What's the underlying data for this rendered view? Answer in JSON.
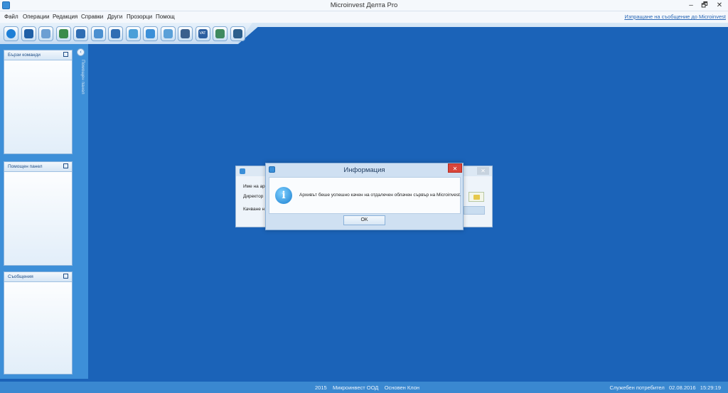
{
  "window": {
    "title": "Microinvest Делта Pro",
    "controls": {
      "minimize": "‒",
      "maximize": "🗗",
      "close": "✕"
    }
  },
  "menu": {
    "items": [
      "Файл",
      "Операции",
      "Редакция",
      "Справки",
      "Други",
      "Прозорци",
      "Помощ"
    ],
    "feedback_link": "Изпращане на съобщение до Microinvest"
  },
  "toolbar": {
    "buttons": [
      "globe-icon",
      "operations-icon",
      "documents-icon",
      "payments-icon",
      "cash-icon",
      "partners-icon",
      "items-icon",
      "users-icon",
      "objects-icon",
      "timer-icon",
      "lock-icon",
      "vat-icon",
      "export-icon",
      "settings-icon"
    ],
    "colors": [
      "#1e7fd6",
      "#1f5fa6",
      "#6c9fd3",
      "#3a8c4a",
      "#2f6db3",
      "#4a8fd0",
      "#2f6db3",
      "#4a9fd8",
      "#3b8fd8",
      "#5aa0d8",
      "#3a5f8c",
      "#2c5fa0",
      "#3f8a5f",
      "#2c5f8c"
    ],
    "vat_label": "VAT"
  },
  "sidebar": {
    "collapse_glyph": "‹",
    "vertical_tab": "Помощен панел",
    "panels": [
      {
        "title": "Бързи команди"
      },
      {
        "title": "Помощен панел"
      },
      {
        "title": "Съобщения"
      }
    ]
  },
  "back_dialog": {
    "close_glyph": "✕",
    "label_name": "Име на ар",
    "label_dir": "Директор",
    "label_upload": "Качване н"
  },
  "info_dialog": {
    "title": "Информация",
    "close_glyph": "✕",
    "icon_glyph": "i",
    "message": "Архивът беше успешно качен на отдалечен облачен сървър на Microinvest.",
    "ok_label": "OK"
  },
  "status": {
    "year": "2015",
    "company": "Микроинвест ООД",
    "branch": "Основен Клон",
    "user": "Служебен потребител",
    "date": "02.08.2016",
    "time": "15:29:19"
  }
}
